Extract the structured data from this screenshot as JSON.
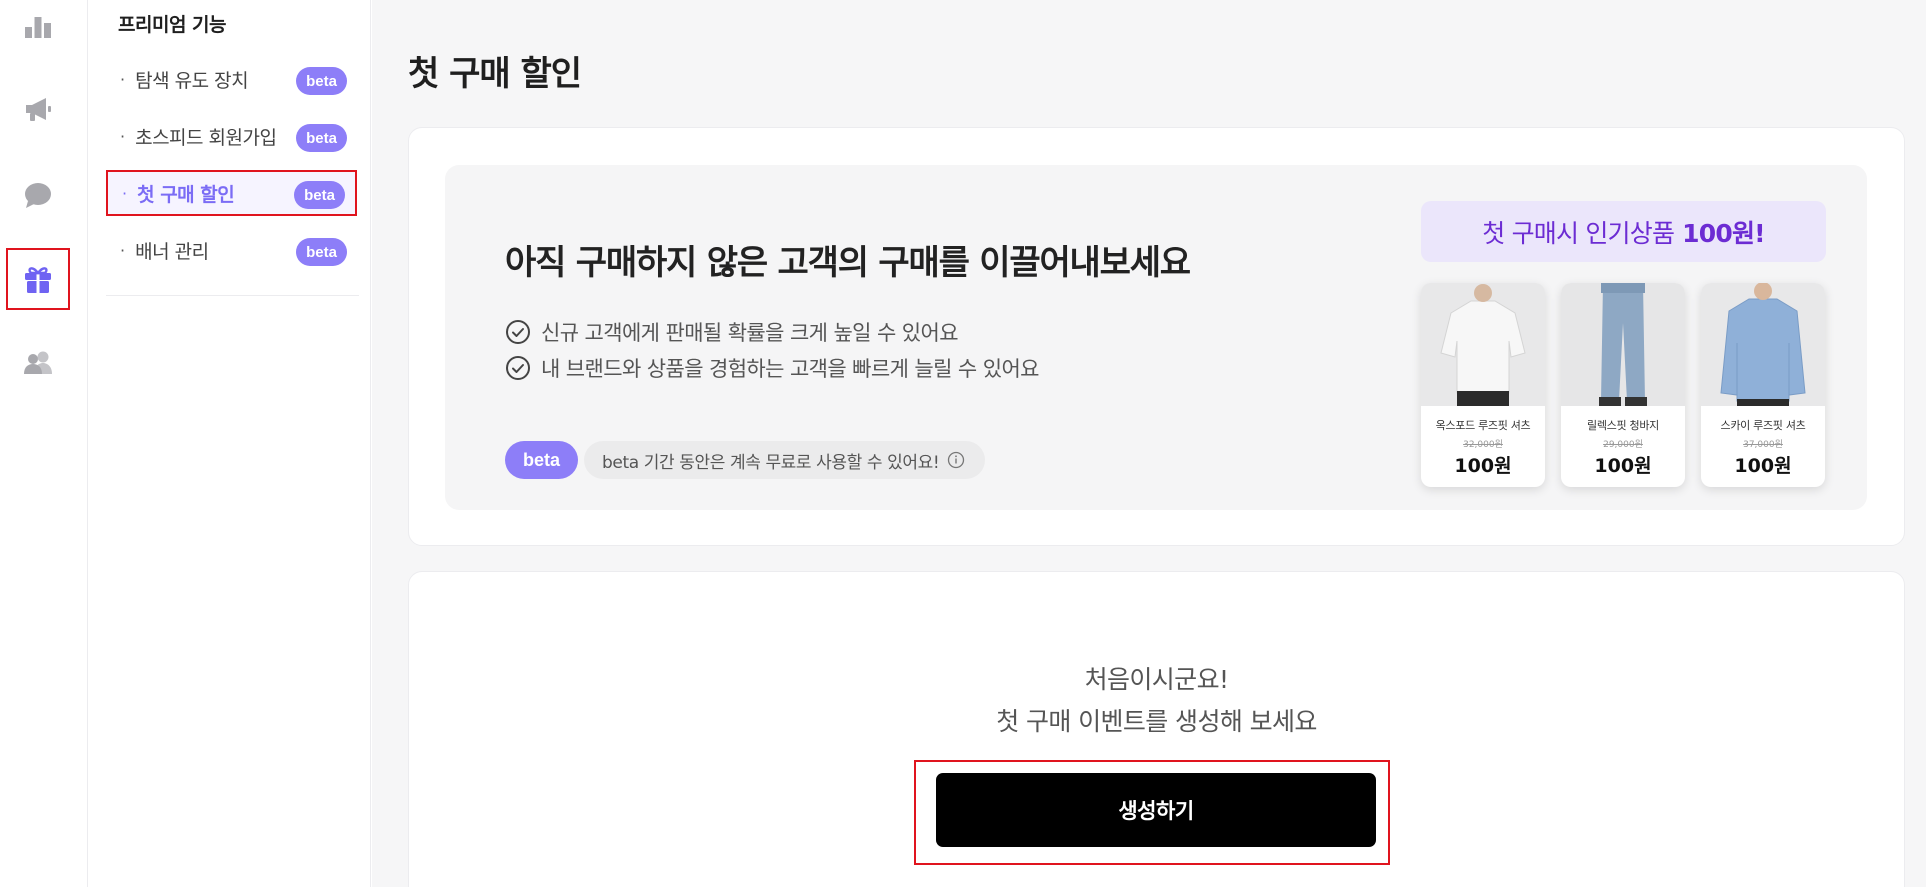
{
  "rail": {
    "items": [
      {
        "icon": "bar-chart-icon"
      },
      {
        "icon": "megaphone-icon"
      },
      {
        "icon": "chat-bubble-icon"
      },
      {
        "icon": "gift-icon",
        "active": true
      },
      {
        "icon": "users-icon"
      }
    ],
    "active_color": "#6f63f2",
    "icon_color": "#a8a8ad"
  },
  "submenu": {
    "title": "프리미엄 기능",
    "items": [
      {
        "label": "탐색 유도 장치",
        "badge": "beta"
      },
      {
        "label": "초스피드 회원가입",
        "badge": "beta"
      },
      {
        "label": "첫 구매 할인",
        "badge": "beta",
        "active": true
      },
      {
        "label": "배너 관리",
        "badge": "beta"
      }
    ]
  },
  "main": {
    "page_title": "첫 구매 할인",
    "hero": {
      "title": "아직 구매하지 않은 고객의 구매를 이끌어내보세요",
      "bullets": [
        "신규 고객에게 판매될 확률을 크게 높일 수 있어요",
        "내 브랜드와 상품을 경험하는 고객을 빠르게 늘릴 수 있어요"
      ],
      "beta_badge": "beta",
      "beta_note": "beta 기간 동안은 계속 무료로 사용할 수 있어요!"
    },
    "promo": {
      "banner_prefix": "첫 구매시 인기상품",
      "banner_price": "100원!",
      "products": [
        {
          "name": "옥스포드 루즈핏 셔츠",
          "original_price": "32,000원",
          "price": "100원"
        },
        {
          "name": "릴렉스핏 청바지",
          "original_price": "29,000원",
          "price": "100원"
        },
        {
          "name": "스카이 루즈핏 셔츠",
          "original_price": "37,000원",
          "price": "100원"
        }
      ]
    },
    "empty_state": {
      "line1": "처음이시군요!",
      "line2": "첫 구매 이벤트를 생성해 보세요",
      "create_button": "생성하기"
    }
  },
  "colors": {
    "accent": "#8d7ef8",
    "promo_text": "#6c2cd3",
    "highlight_border": "#e0141e"
  }
}
